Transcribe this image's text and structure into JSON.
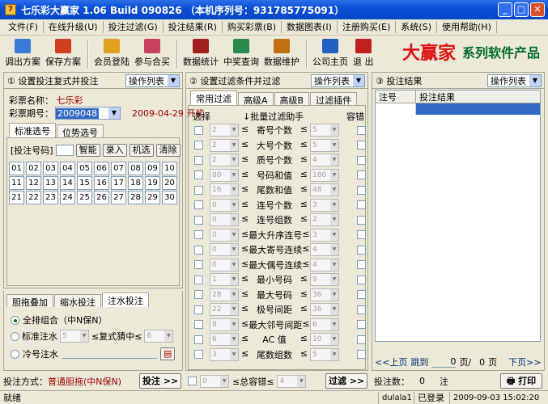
{
  "window": {
    "title": "七乐彩大赢家 1.06 Build 090826 （本机序列号：931785775091）",
    "buttons": [
      "_",
      "□",
      "✕"
    ]
  },
  "menu": [
    "文件(F)",
    "在线升级(U)",
    "投注过滤(G)",
    "投注结果(R)",
    "购买彩票(B)",
    "数据图表(I)",
    "注册购买(E)",
    "系统(S)",
    "使用帮助(H)"
  ],
  "toolbar": [
    {
      "label": "调出方案",
      "color": "#3a7bd5"
    },
    {
      "label": "保存方案",
      "color": "#d04020"
    },
    {
      "label": "会员登陆",
      "color": "#e0a020"
    },
    {
      "label": "参与合买",
      "color": "#c84060"
    },
    {
      "label": "数据统计",
      "color": "#a02020"
    },
    {
      "label": "中奖查询",
      "color": "#2a8a4a"
    },
    {
      "label": "数据维护",
      "color": "#c07010"
    },
    {
      "label": "公司主页",
      "color": "#2060c0"
    },
    {
      "label": "退 出",
      "color": "#c02020"
    }
  ],
  "brand": {
    "big": "大赢家",
    "small": "系列软件产品"
  },
  "left": {
    "header": "① 设置投注复式并投注",
    "combo": "操作列表",
    "name_label": "彩票名称：",
    "name_value": "七乐彩",
    "issue_label": "彩票期号：",
    "issue_value": "2009048",
    "date": "2009-04-29 开奖",
    "tabs": [
      "标准选号",
      "位势选号"
    ],
    "num_label": "[投注号码]",
    "btns": [
      "智能",
      "录入",
      "机选",
      "清除"
    ],
    "numbers": [
      "01",
      "02",
      "03",
      "04",
      "05",
      "06",
      "07",
      "08",
      "09",
      "10",
      "11",
      "12",
      "13",
      "14",
      "15",
      "16",
      "17",
      "18",
      "19",
      "20",
      "21",
      "22",
      "23",
      "24",
      "25",
      "26",
      "27",
      "28",
      "29",
      "30"
    ],
    "tabs2": [
      "胆拖叠加",
      "缩水投注",
      "注水投注"
    ],
    "opt1": "全排组合（中N保N）",
    "opt2": "标准注水",
    "opt2_mid": "≤复式猜中≤",
    "opt2_a": "5",
    "opt2_b": "6",
    "opt3": "冷号注水",
    "method_label": "投注方式：",
    "method_value": "普通胆拖(中N保N)",
    "bet_btn": "投注 >>"
  },
  "mid": {
    "header": "② 设置过滤条件并过滤",
    "combo": "操作列表",
    "tabs": [
      "常用过滤",
      "高级A",
      "高级B",
      "过滤插件"
    ],
    "col_sel": "选择",
    "col_helper": "↓批量过滤助手",
    "col_tol": "容错",
    "rows": [
      {
        "lo": "2",
        "name": "寄号个数",
        "hi": "5"
      },
      {
        "lo": "2",
        "name": "大号个数",
        "hi": "5"
      },
      {
        "lo": "2",
        "name": "质号个数",
        "hi": "4"
      },
      {
        "lo": "80",
        "name": "号码和值",
        "hi": "180"
      },
      {
        "lo": "16",
        "name": "尾数和值",
        "hi": "48"
      },
      {
        "lo": "0",
        "name": "连号个数",
        "hi": "3"
      },
      {
        "lo": "0",
        "name": "连号组数",
        "hi": "2"
      },
      {
        "lo": "0",
        "name": "最大升序连号",
        "hi": "3"
      },
      {
        "lo": "0",
        "name": "最大寄号连续",
        "hi": "4"
      },
      {
        "lo": "0",
        "name": "最大偶号连续",
        "hi": "4"
      },
      {
        "lo": "1",
        "name": "最小号码",
        "hi": "9"
      },
      {
        "lo": "28",
        "name": "最大号码",
        "hi": "36"
      },
      {
        "lo": "22",
        "name": "极号间距",
        "hi": "36"
      },
      {
        "lo": "8",
        "name": "最大邻号间距",
        "hi": "6"
      },
      {
        "lo": "6",
        "name": "AC 值",
        "hi": "10"
      },
      {
        "lo": "3",
        "name": "尾数组数",
        "hi": "5"
      }
    ],
    "tol_lo": "0",
    "tol_label": "≤总容错≤",
    "tol_hi": "4",
    "filter_btn": "过滤 >>"
  },
  "right": {
    "header": "③ 投注结果",
    "combo": "操作列表",
    "col1": "注号",
    "col2": "投注结果",
    "nav_prev": "<<上页",
    "nav_jump": "跳到",
    "nav_page": "0",
    "nav_sep": "页/",
    "nav_total": "0",
    "nav_unit": "页",
    "nav_next": "下页>>",
    "count_label": "投注数：",
    "count_value": "0",
    "count_unit": "注",
    "print_btn": "打印"
  },
  "status": {
    "left": "就绪",
    "user": "dulala1",
    "state": "已登录",
    "time": "2009-09-03 15:02:20"
  }
}
